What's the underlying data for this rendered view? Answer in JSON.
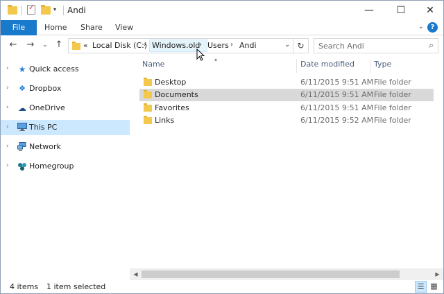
{
  "window": {
    "title": "Andi",
    "controls": {
      "minimize": "—",
      "maximize": "☐",
      "close": "✕"
    }
  },
  "ribbon": {
    "tabs": [
      {
        "label": "File"
      },
      {
        "label": "Home"
      },
      {
        "label": "Share"
      },
      {
        "label": "View"
      }
    ],
    "help": "?"
  },
  "nav": {
    "back": "←",
    "forward": "→",
    "recent": "⌄",
    "up": "↑"
  },
  "address": {
    "overflow": "«",
    "crumbs": [
      "Local Disk (C:)",
      "Windows.old",
      "Users",
      "Andi"
    ],
    "separator": "›",
    "highlighted_crumb": "Windows.old"
  },
  "search": {
    "placeholder": "Search Andi"
  },
  "navpane": {
    "items": [
      {
        "label": "Quick access",
        "icon": "star-icon",
        "selected": false
      },
      {
        "label": "Dropbox",
        "icon": "dropbox-icon",
        "selected": false
      },
      {
        "label": "OneDrive",
        "icon": "cloud-icon",
        "selected": false
      },
      {
        "label": "This PC",
        "icon": "computer-icon",
        "selected": true
      },
      {
        "label": "Network",
        "icon": "network-icon",
        "selected": false
      },
      {
        "label": "Homegroup",
        "icon": "homegroup-icon",
        "selected": false
      }
    ]
  },
  "columns": {
    "name": "Name",
    "date": "Date modified",
    "type": "Type"
  },
  "files": [
    {
      "name": "Desktop",
      "date": "6/11/2015 9:51 AM",
      "type": "File folder",
      "selected": false
    },
    {
      "name": "Documents",
      "date": "6/11/2015 9:51 AM",
      "type": "File folder",
      "selected": true
    },
    {
      "name": "Favorites",
      "date": "6/11/2015 9:51 AM",
      "type": "File folder",
      "selected": false
    },
    {
      "name": "Links",
      "date": "6/11/2015 9:52 AM",
      "type": "File folder",
      "selected": false
    }
  ],
  "status": {
    "item_count": "4 items",
    "selection": "1 item selected"
  },
  "colors": {
    "accent": "#1979ca",
    "selection_nav": "#cce8ff",
    "selection_row": "#d9d9d9",
    "folder": "#f2c94c"
  }
}
